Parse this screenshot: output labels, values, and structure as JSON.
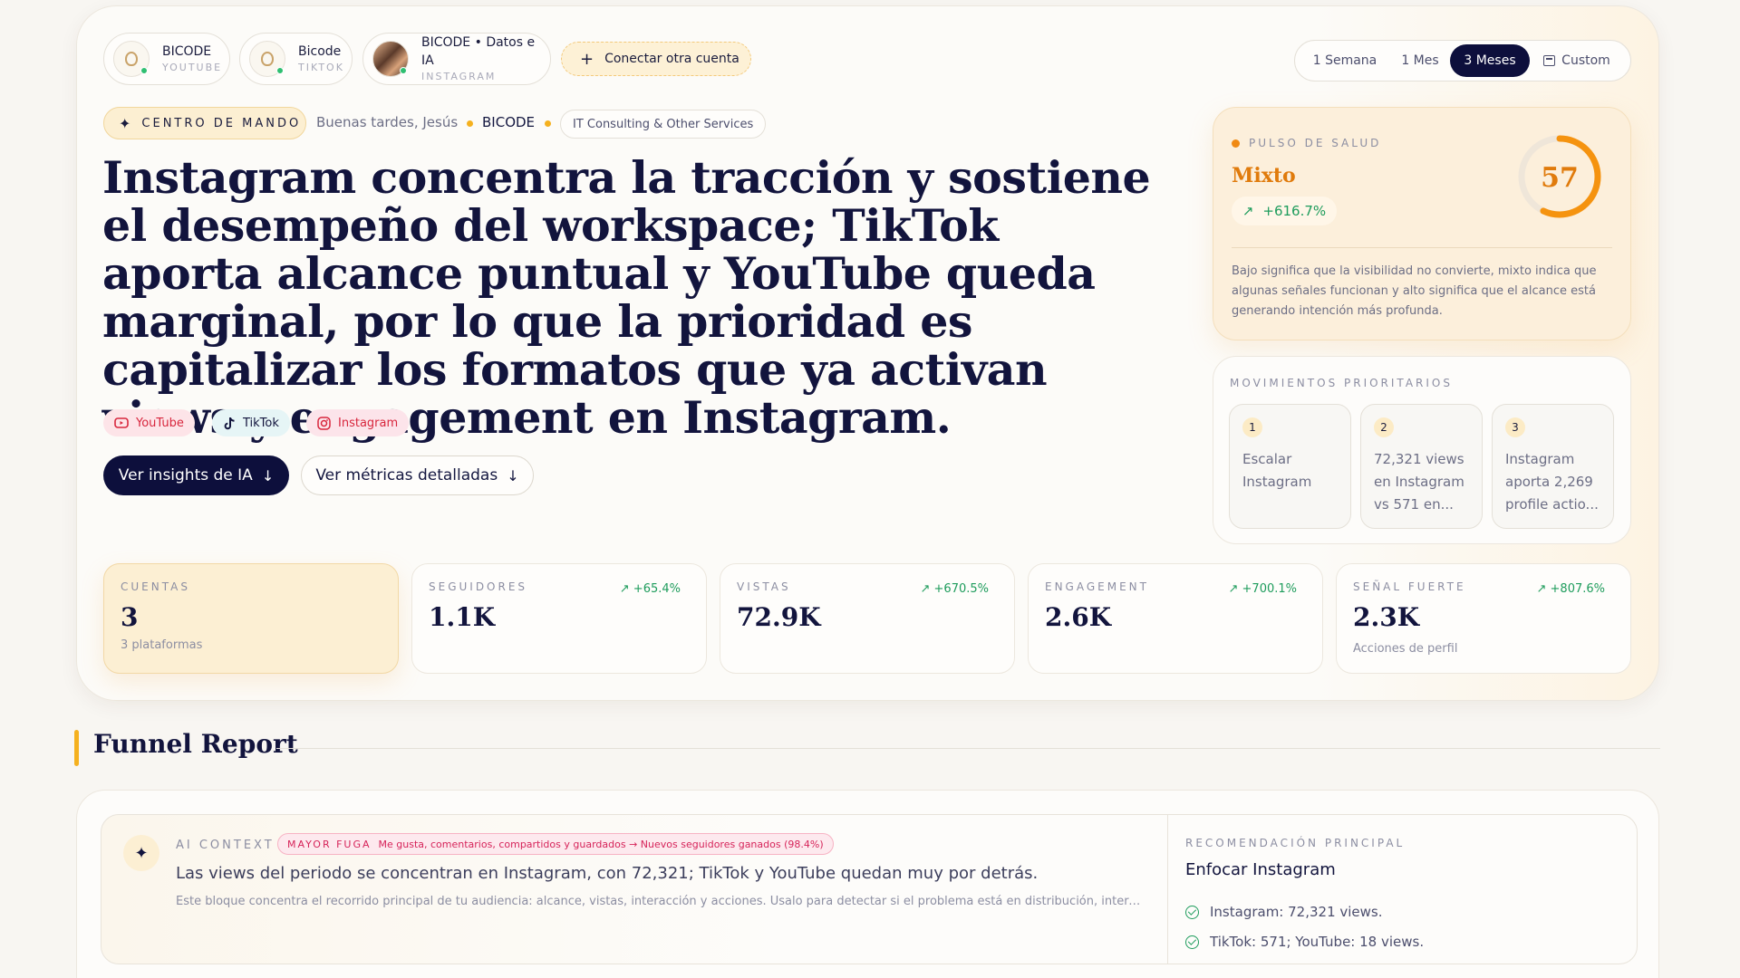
{
  "accounts": [
    {
      "name": "BICODE",
      "platform": "YOUTUBE"
    },
    {
      "name": "Bicode",
      "platform": "TIKTOK"
    },
    {
      "name": "BICODE • Datos e IA",
      "platform": "INSTAGRAM"
    }
  ],
  "connect_label": "Conectar otra cuenta",
  "time_range": {
    "options": [
      "1 Semana",
      "1 Mes",
      "3 Meses",
      "Custom"
    ],
    "selected": "3 Meses"
  },
  "header": {
    "badge": "CENTRO DE MANDO",
    "greeting": "Buenas tardes, Jesús",
    "workspace": "BICODE",
    "industry": "IT Consulting & Other Services"
  },
  "headline": "Instagram concentra la tracción y sostiene el desempeño del workspace; TikTok aporta alcance puntual y YouTube queda marginal, por lo que la prioridad es capitalizar los formatos que ya activan views y engagement en Instagram.",
  "platform_tags": [
    "YouTube",
    "TikTok",
    "Instagram"
  ],
  "buttons": {
    "insights": "Ver insights de IA",
    "metrics": "Ver métricas detalladas"
  },
  "health": {
    "label": "PULSO DE SALUD",
    "state": "Mixto",
    "delta": "+616.7%",
    "score": "57",
    "score_value": 57,
    "description": "Bajo significa que la visibilidad no convierte, mixto indica que algunas señales funcionan y alto significa que el alcance está generando intención más profunda."
  },
  "moves": {
    "title": "MOVIMIENTOS PRIORITARIOS",
    "items": [
      {
        "num": "1",
        "text": "Escalar Instagram"
      },
      {
        "num": "2",
        "text": "72,321 views en Instagram vs 571 en..."
      },
      {
        "num": "3",
        "text": "Instagram aporta 2,269 profile actio..."
      }
    ]
  },
  "kpis": [
    {
      "label": "CUENTAS",
      "value": "3",
      "sub": "3 plataformas",
      "delta": ""
    },
    {
      "label": "SEGUIDORES",
      "value": "1.1K",
      "sub": "",
      "delta": "+65.4%"
    },
    {
      "label": "VISTAS",
      "value": "72.9K",
      "sub": "",
      "delta": "+670.5%"
    },
    {
      "label": "ENGAGEMENT",
      "value": "2.6K",
      "sub": "",
      "delta": "+700.1%"
    },
    {
      "label": "SEÑAL FUERTE",
      "value": "2.3K",
      "sub": "Acciones de perfil",
      "delta": "+807.6%"
    }
  ],
  "funnel": {
    "title": "Funnel Report",
    "ai_label": "AI CONTEXT",
    "leak_key": "MAYOR FUGA",
    "leak_text": "Me gusta, comentarios, compartidos y guardados → Nuevos seguidores ganados (98.4%)",
    "main_text": "Las views del periodo se concentran en Instagram, con 72,321; TikTok y YouTube quedan muy por detrás.",
    "sub_text": "Este bloque concentra el recorrido principal de tu audiencia: alcance, vistas, interacción y acciones. Úsalo para detectar si el problema está en distribución, interés...",
    "rec_label": "RECOMENDACIÓN PRINCIPAL",
    "rec_title": "Enfocar Instagram",
    "rec_items": [
      "Instagram: 72,321 views.",
      "TikTok: 571; YouTube: 18 views."
    ]
  },
  "colors": {
    "primary": "#0d0f3c",
    "accent": "#f5b11f",
    "health_orange": "#f08a14",
    "positive": "#1e9c5c",
    "leak": "#d6245a"
  },
  "icons": {
    "command": "sparkles-icon",
    "calendar": "calendar-icon",
    "check": "check-circle-icon",
    "arrow": "arrow-up-right-icon"
  }
}
